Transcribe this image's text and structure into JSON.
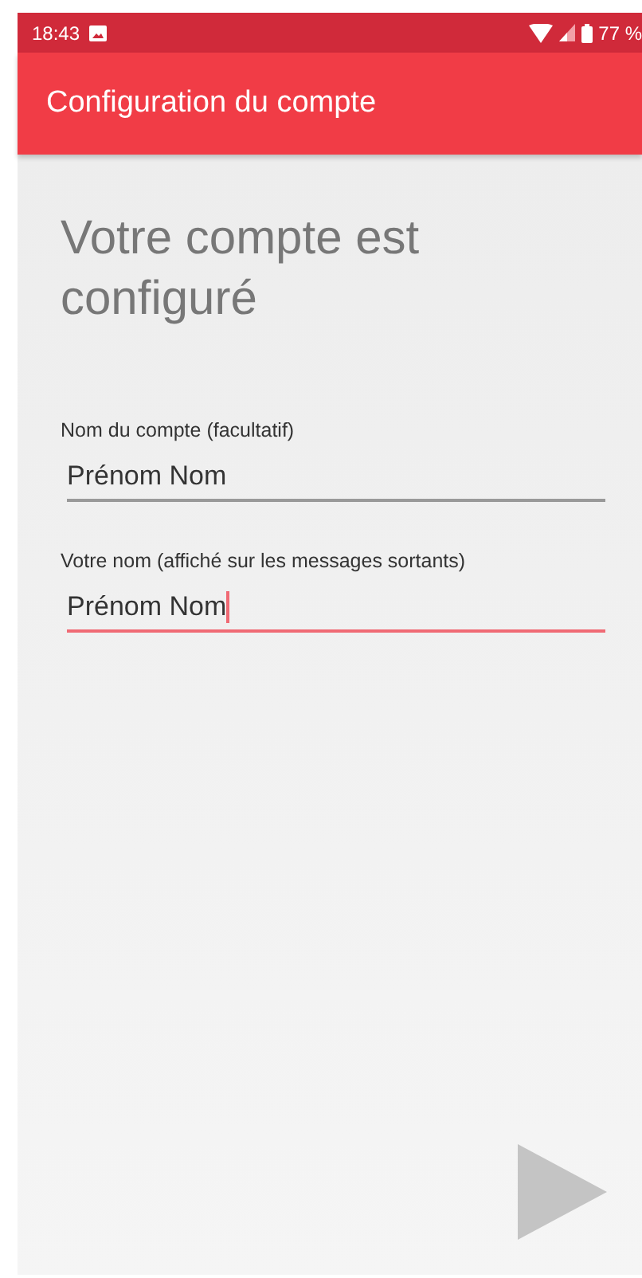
{
  "status_bar": {
    "time": "18:43",
    "battery": "77 %"
  },
  "app_bar": {
    "title": "Configuration du compte"
  },
  "heading": "Votre compte est configuré",
  "fields": [
    {
      "label": "Nom du compte (facultatif)",
      "value": "Prénom Nom",
      "focused": false
    },
    {
      "label": "Votre nom (affiché sur les messages sortants)",
      "value": "Prénom Nom",
      "focused": true
    }
  ],
  "next_button": {
    "disabled": true
  }
}
